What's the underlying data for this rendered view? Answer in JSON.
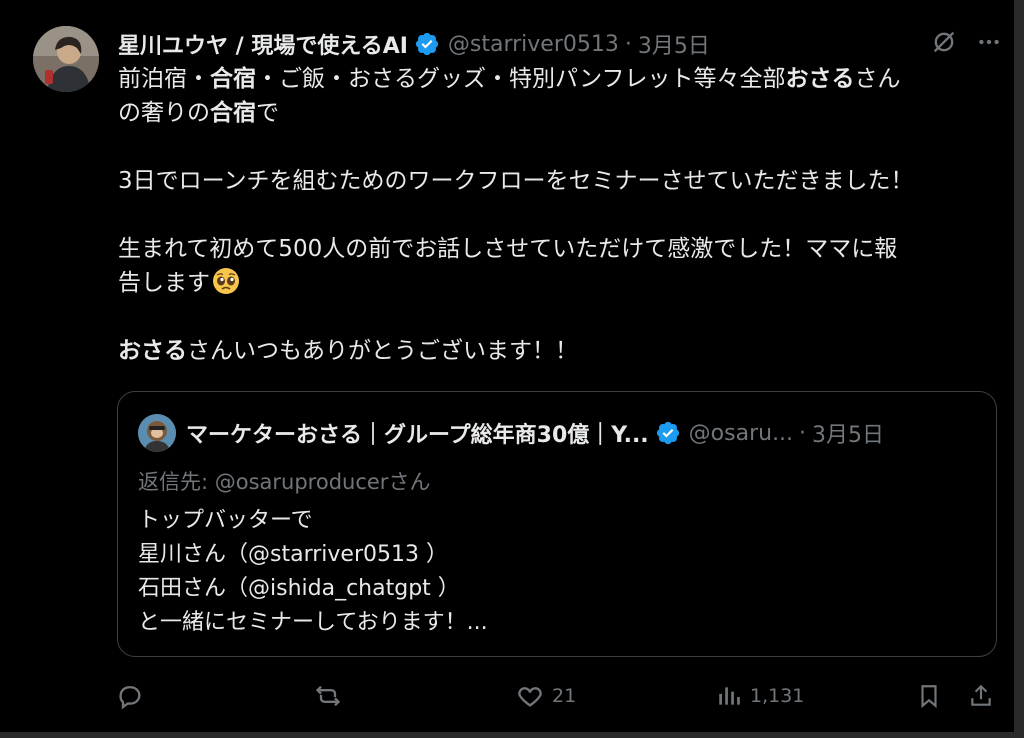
{
  "tweet": {
    "author": {
      "display_name": "星川ユウヤ / 現場で使えるAI",
      "handle": "@starriver0513",
      "date": "3月5日"
    },
    "separator": "·",
    "text": {
      "line1_a": "前泊宿・",
      "line1_b": "合宿",
      "line1_c": "・ご飯・おさるグッズ・特別パンフレット等々全部",
      "line1_d": "おさる",
      "line1_e": "さん",
      "line2_a": "の奢りの",
      "line2_b": "合宿",
      "line2_c": "で",
      "para2": "3日でローンチを組むためのワークフローをセミナーさせていただきました！",
      "para3_line1": "生まれて初めて500人の前でお話しさせていただけて感激でした！ママに報",
      "para3_line2": "告します",
      "para4_a": "おさる",
      "para4_b": "さんいつもありがとうございます！！"
    },
    "emoji": "pleading-face-emoji"
  },
  "quote": {
    "author": {
      "display_name": "マーケターおさる｜グループ総年商30億｜Y...",
      "handle": "@osaru...",
      "date": "3月5日"
    },
    "replying_to": "返信先: @osaruproducerさん",
    "lines": [
      "トップバッターで",
      "星川さん（@starriver0513 ）",
      "石田さん（@ishida_chatgpt ）",
      "と一緒にセミナーしております！..."
    ]
  },
  "actions": {
    "reply_count": "",
    "retweet_count": "",
    "like_count": "21",
    "views_count": "1,131"
  },
  "colors": {
    "background": "#000000",
    "text_primary": "#e7e9ea",
    "text_secondary": "#71767b",
    "verified": "#1d9bf0",
    "border": "#3a3f44"
  }
}
